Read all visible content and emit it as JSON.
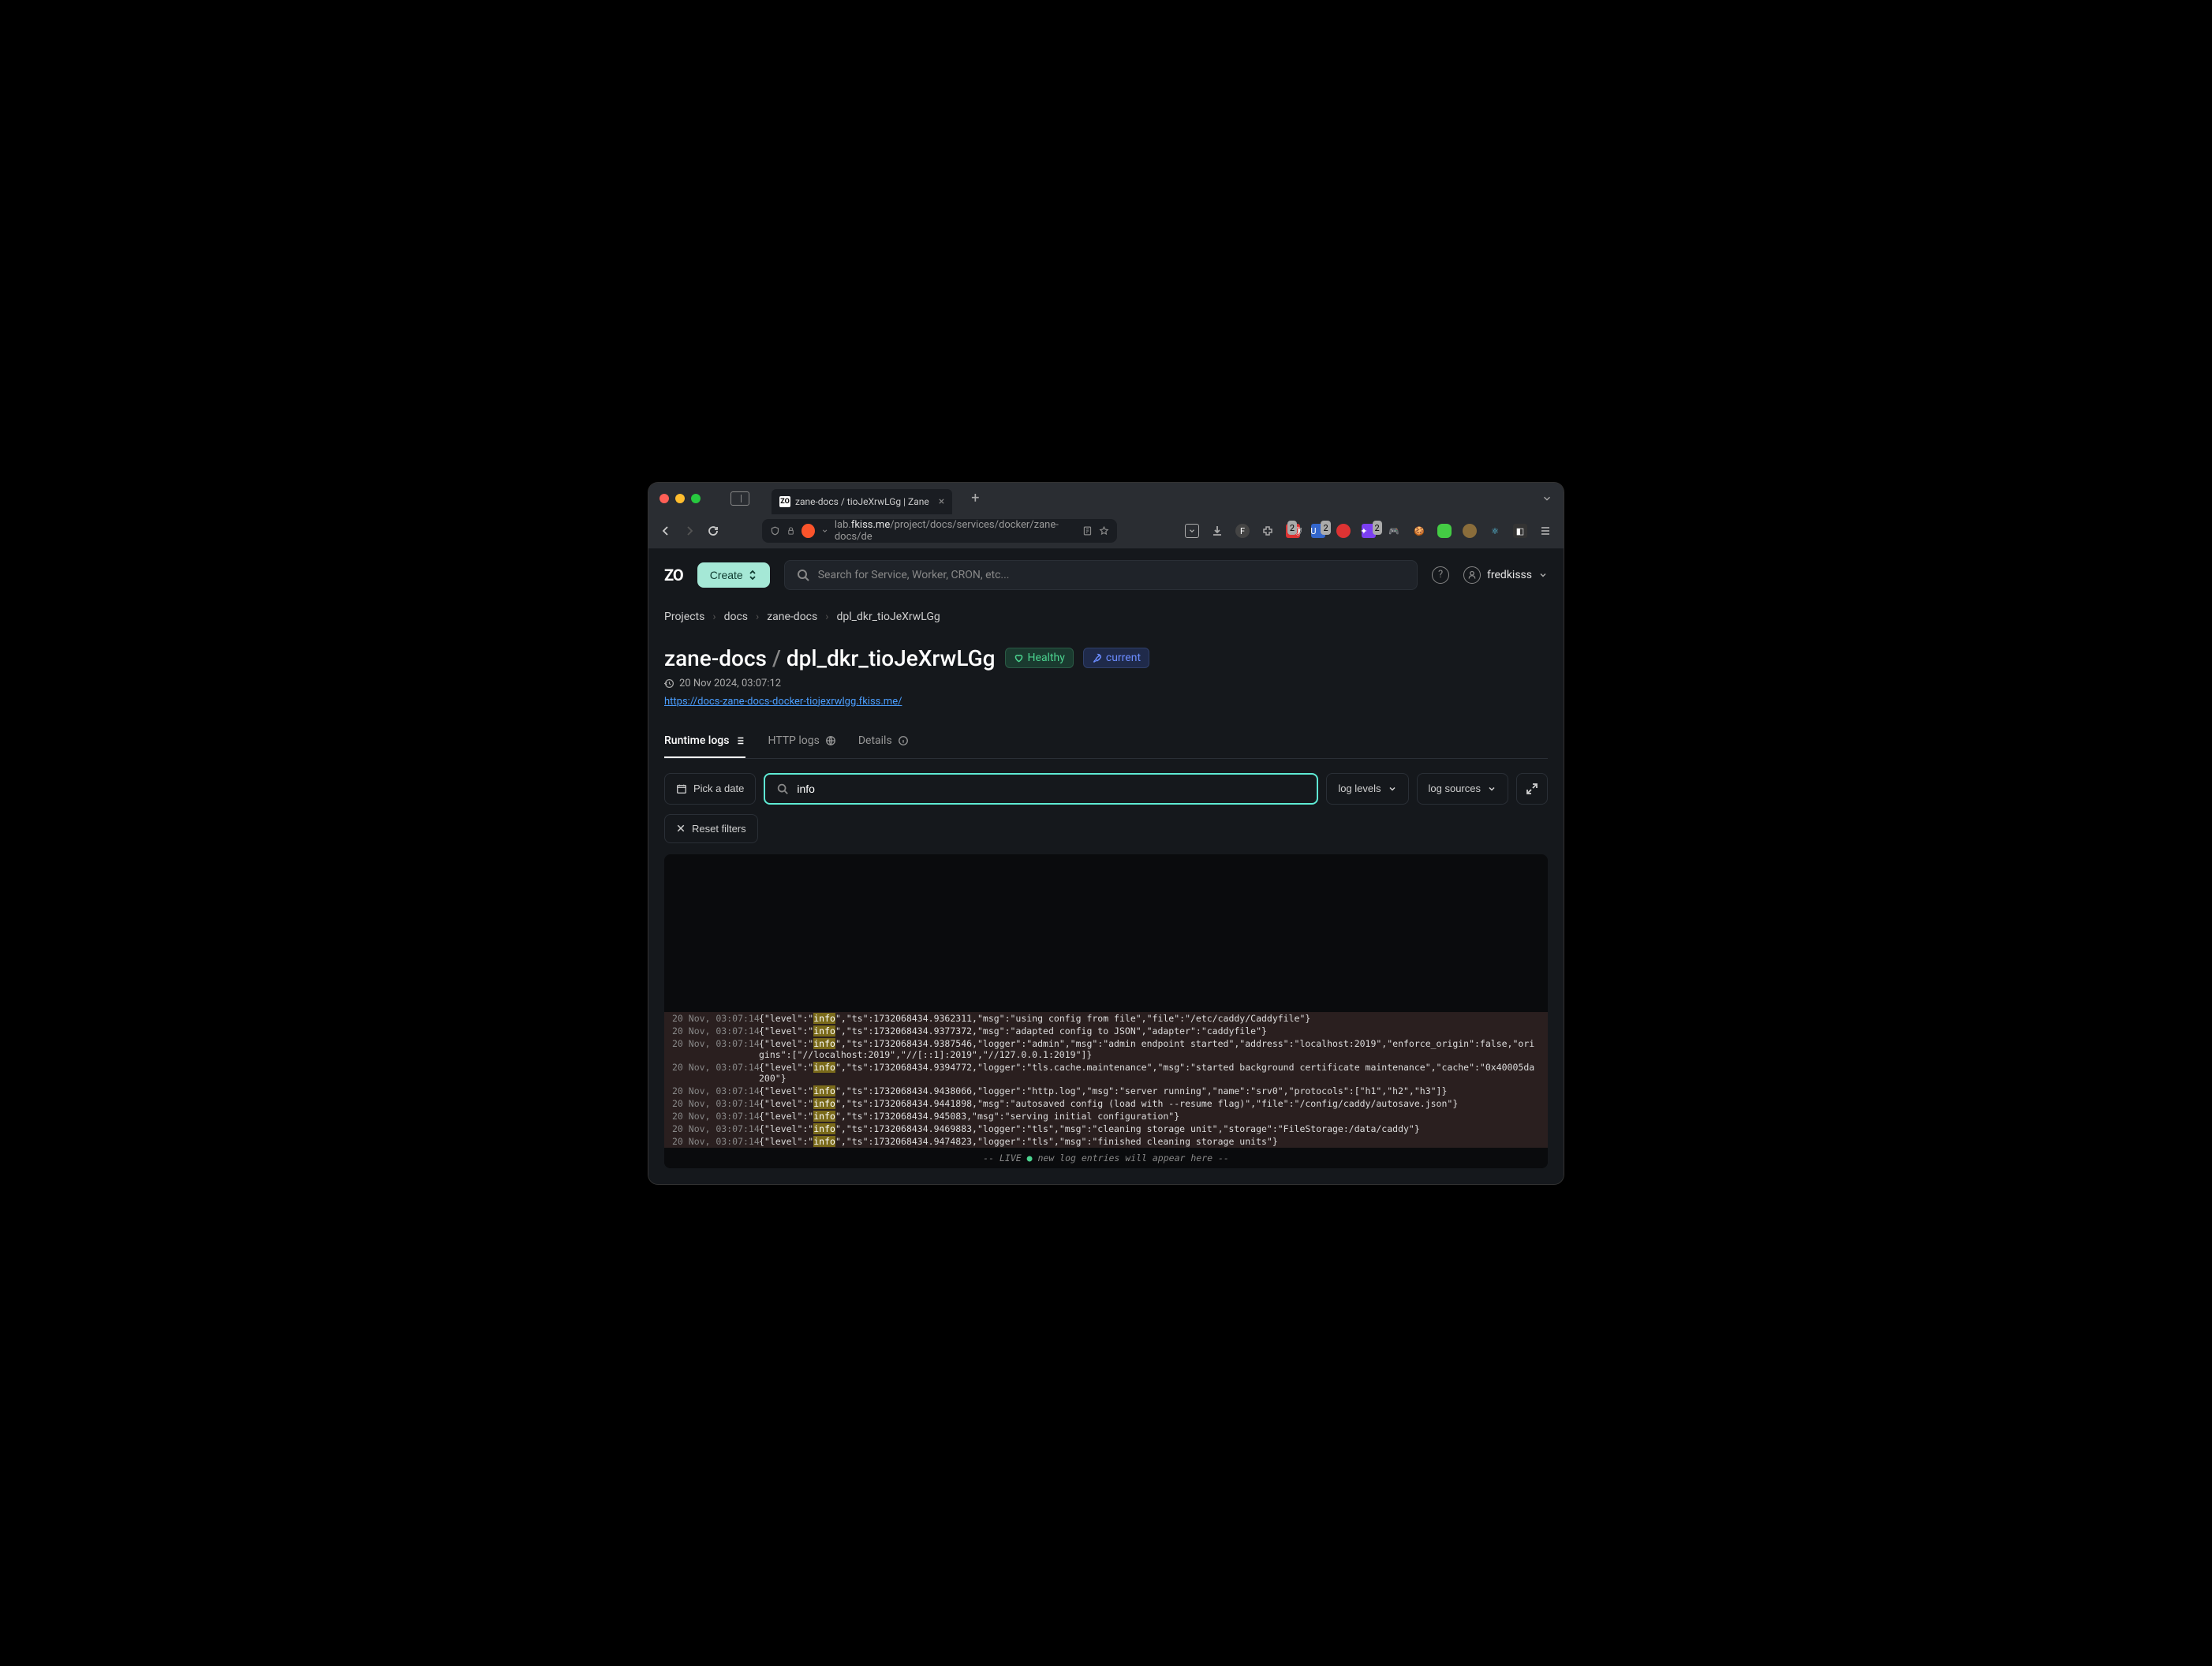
{
  "browser": {
    "tab_title": "zane-docs / tioJeXrwLGg | Zane",
    "url_prefix": "lab.",
    "url_host": "fkiss.me",
    "url_path": "/project/docs/services/docker/zane-docs/de",
    "ext_badges": [
      "2",
      "2",
      "2"
    ]
  },
  "header": {
    "logo": "ZO",
    "create_label": "Create",
    "search_placeholder": "Search for Service, Worker, CRON, etc...",
    "username": "fredkisss"
  },
  "breadcrumbs": [
    "Projects",
    "docs",
    "zane-docs",
    "dpl_dkr_tioJeXrwLGg"
  ],
  "page": {
    "service": "zane-docs",
    "deployment": "dpl_dkr_tioJeXrwLGg",
    "badge_healthy": "Healthy",
    "badge_current": "current",
    "datetime": "20 Nov 2024, 03:07:12",
    "url": "https://docs-zane-docs-docker-tiojexrwlgg.fkiss.me/"
  },
  "tabs": {
    "runtime": "Runtime logs",
    "http": "HTTP logs",
    "details": "Details"
  },
  "filters": {
    "date": "Pick a date",
    "search_value": "info",
    "levels": "log levels",
    "sources": "log sources",
    "reset": "Reset filters"
  },
  "logs": [
    {
      "ts": "20 Nov, 03:07:14",
      "pre": "{\"level\":\"",
      "hl": "info",
      "post": "\",\"ts\":1732068434.9362311,\"msg\":\"using config from file\",\"file\":\"/etc/caddy/Caddyfile\"}"
    },
    {
      "ts": "20 Nov, 03:07:14",
      "pre": "{\"level\":\"",
      "hl": "info",
      "post": "\",\"ts\":1732068434.9377372,\"msg\":\"adapted config to JSON\",\"adapter\":\"caddyfile\"}"
    },
    {
      "ts": "20 Nov, 03:07:14",
      "pre": "{\"level\":\"",
      "hl": "info",
      "post": "\",\"ts\":1732068434.9387546,\"logger\":\"admin\",\"msg\":\"admin endpoint started\",\"address\":\"localhost:2019\",\"enforce_origin\":false,\"origins\":[\"//localhost:2019\",\"//[::1]:2019\",\"//127.0.0.1:2019\"]}"
    },
    {
      "ts": "20 Nov, 03:07:14",
      "pre": "{\"level\":\"",
      "hl": "info",
      "post": "\",\"ts\":1732068434.9394772,\"logger\":\"tls.cache.maintenance\",\"msg\":\"started background certificate maintenance\",\"cache\":\"0x40005da200\"}"
    },
    {
      "ts": "20 Nov, 03:07:14",
      "pre": "{\"level\":\"",
      "hl": "info",
      "post": "\",\"ts\":1732068434.9438066,\"logger\":\"http.log\",\"msg\":\"server running\",\"name\":\"srv0\",\"protocols\":[\"h1\",\"h2\",\"h3\"]}"
    },
    {
      "ts": "20 Nov, 03:07:14",
      "pre": "{\"level\":\"",
      "hl": "info",
      "post": "\",\"ts\":1732068434.9441898,\"msg\":\"autosaved config (load with --resume flag)\",\"file\":\"/config/caddy/autosave.json\"}"
    },
    {
      "ts": "20 Nov, 03:07:14",
      "pre": "{\"level\":\"",
      "hl": "info",
      "post": "\",\"ts\":1732068434.945083,\"msg\":\"serving initial configuration\"}"
    },
    {
      "ts": "20 Nov, 03:07:14",
      "pre": "{\"level\":\"",
      "hl": "info",
      "post": "\",\"ts\":1732068434.9469883,\"logger\":\"tls\",\"msg\":\"cleaning storage unit\",\"storage\":\"FileStorage:/data/caddy\"}"
    },
    {
      "ts": "20 Nov, 03:07:14",
      "pre": "{\"level\":\"",
      "hl": "info",
      "post": "\",\"ts\":1732068434.9474823,\"logger\":\"tls\",\"msg\":\"finished cleaning storage units\"}"
    }
  ],
  "log_footer": {
    "dashes": "--",
    "live": "LIVE",
    "tail": "new log entries will appear here --"
  }
}
